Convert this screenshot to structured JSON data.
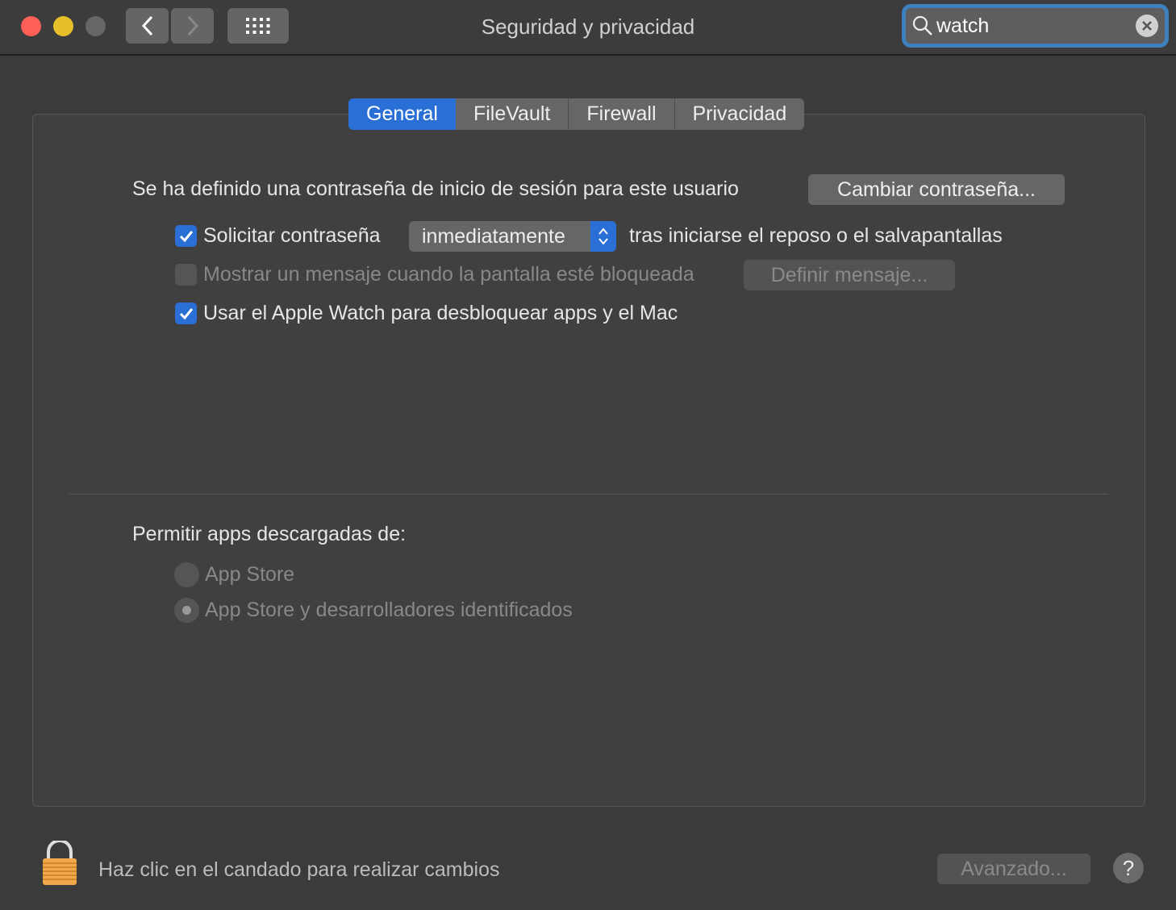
{
  "window": {
    "title": "Seguridad y privacidad"
  },
  "search": {
    "value": "watch"
  },
  "tabs": [
    {
      "label": "General",
      "selected": true
    },
    {
      "label": "FileVault"
    },
    {
      "label": "Firewall"
    },
    {
      "label": "Privacidad"
    }
  ],
  "general": {
    "password_text": "Se ha definido una contraseña de inicio de sesión para este usuario",
    "change_password": "Cambiar contraseña...",
    "require_password": {
      "label": "Solicitar contraseña",
      "checked": true,
      "popup_value": "inmediatamente",
      "suffix": "tras iniciarse el reposo o el salvapantallas"
    },
    "show_message": {
      "label": "Mostrar un mensaje cuando la pantalla esté bloqueada",
      "checked": false,
      "button": "Definir mensaje..."
    },
    "apple_watch": {
      "label": "Usar el Apple Watch para desbloquear apps y el Mac",
      "checked": true
    },
    "allow_apps_label": "Permitir apps descargadas de:",
    "radio": [
      {
        "label": "App Store",
        "selected": false
      },
      {
        "label": "App Store y desarrolladores identificados",
        "selected": true
      }
    ]
  },
  "footer": {
    "lock_text": "Haz clic en el candado para realizar cambios",
    "advanced": "Avanzado...",
    "help": "?"
  },
  "colors": {
    "accent": "#2a6fd6",
    "close": "#fe5f57",
    "minimize": "#e6c02a",
    "lock": "#f0a848"
  }
}
